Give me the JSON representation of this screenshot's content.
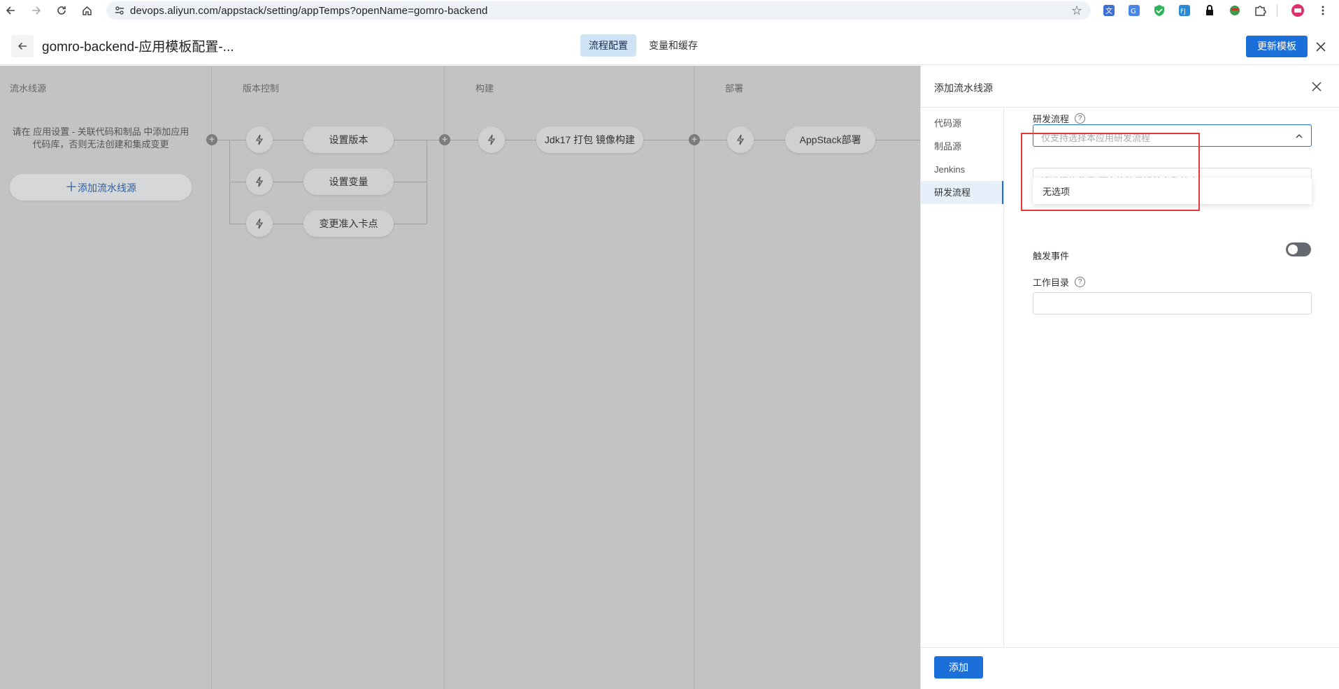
{
  "browser": {
    "url": "devops.aliyun.com/appstack/setting/appTemps?openName=gomro-backend",
    "extensions": [
      "translate-icon",
      "google-translate-icon",
      "shield-check-icon",
      "fj-icon",
      "lock-icon",
      "character-icon",
      "puzzle-icon"
    ]
  },
  "header": {
    "title": "gomro-backend-应用模板配置-...",
    "tabs": [
      {
        "label": "流程配置",
        "active": true
      },
      {
        "label": "变量和缓存",
        "active": false
      }
    ],
    "update_button": "更新模板"
  },
  "canvas": {
    "columns": [
      "流水线源",
      "版本控制",
      "构建",
      "部署"
    ],
    "source_hint": "请在 应用设置 - 关联代码和制品 中添加应用代码库，否则无法创建和集成变更",
    "add_source": "添加流水线源",
    "version_jobs": [
      "设置版本",
      "设置变量",
      "变更准入卡点"
    ],
    "build_jobs": [
      "Jdk17 打包 镜像构建"
    ],
    "deploy_jobs": [
      "AppStack部署"
    ]
  },
  "drawer": {
    "title": "添加流水线源",
    "nav": [
      {
        "label": "代码源",
        "active": false
      },
      {
        "label": "制品源",
        "active": false
      },
      {
        "label": "Jenkins",
        "active": false
      },
      {
        "label": "研发流程",
        "active": true
      }
    ],
    "flow_label": "研发流程",
    "flow_placeholder": "仅支持选择本应用研发流程",
    "dropdown_option": "无选项",
    "build_placeholder": "请选择构件号/更多构建号请按名称搜索",
    "trigger_label": "触发事件",
    "trigger_on": false,
    "workdir_label": "工作目录",
    "add_button": "添加"
  },
  "colors": {
    "primary": "#1b6fd8",
    "highlight_box": "#e53935"
  }
}
